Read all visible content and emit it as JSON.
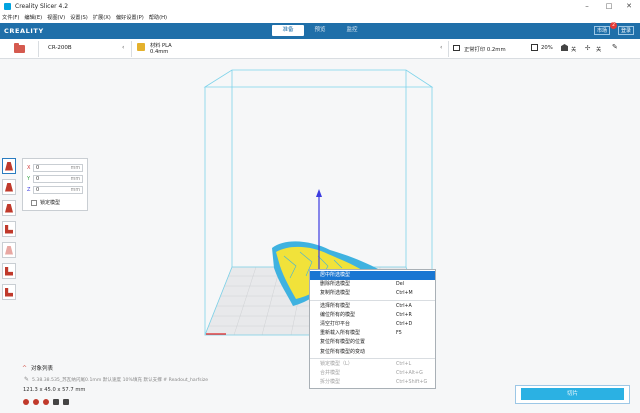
{
  "window": {
    "title": "Creality Slicer 4.2",
    "controls": {
      "minimize": "–",
      "maximize": "□",
      "close": "✕"
    }
  },
  "menubar": {
    "items": [
      "文件(F)",
      "编辑(E)",
      "视图(V)",
      "设置(S)",
      "扩展(X)",
      "偏好设置(P)",
      "帮助(H)"
    ]
  },
  "header": {
    "logo": "CREALITY",
    "tabs": [
      "准备",
      "预览",
      "监控"
    ],
    "active_tab": 0,
    "buttons": {
      "left": "市场",
      "right": "登录"
    },
    "badge": "2"
  },
  "toolbar": {
    "printer": "CR-200B",
    "material_label": "材料 PLA",
    "material_sub": "0.4mm",
    "quality": "正常打印 0.2mm",
    "infill": "20%",
    "support": "关",
    "adhesion": "关"
  },
  "icons": {
    "open_file": "folder-icon",
    "chevron": "‹",
    "edit": "✎",
    "adhesion": "✢"
  },
  "move_panel": {
    "x_label": "X",
    "x_value": "0",
    "x_unit": "mm",
    "y_label": "Y",
    "y_value": "0",
    "y_unit": "mm",
    "z_label": "Z",
    "z_value": "0",
    "z_unit": "mm",
    "lock_label": "锁定模型"
  },
  "context_menu": {
    "items": [
      {
        "label": "居中所选模型",
        "shortcut": "",
        "highlighted": true
      },
      {
        "label": "删除所选模型",
        "shortcut": "Del"
      },
      {
        "label": "复制所选模型",
        "shortcut": "Ctrl+M"
      },
      {
        "label": "选择所有模型",
        "shortcut": "Ctrl+A"
      },
      {
        "label": "编位所有的模型",
        "shortcut": "Ctrl+R"
      },
      {
        "label": "清空打印平台",
        "shortcut": "Ctrl+D"
      },
      {
        "label": "重新载入所有模型",
        "shortcut": "F5"
      },
      {
        "label": "复位所有模型的位置",
        "shortcut": ""
      },
      {
        "label": "复位所有模型的变动",
        "shortcut": ""
      },
      {
        "label": "锁定模型（L）",
        "shortcut": "Ctrl+L",
        "disabled": true
      },
      {
        "label": "合并模型",
        "shortcut": "Ctrl+Alt+G",
        "disabled": true
      },
      {
        "label": "拆分模型",
        "shortcut": "Ctrl+Shift+G",
        "disabled": true
      }
    ]
  },
  "object_list": {
    "header": "对象列表",
    "caret": "^",
    "row": "5.38.38.535_苏瓦纳闪尾0.1mm 默认速度 10%填充 默认支撑 # Readout_harfsize",
    "dimensions": "121.3 x 45.0 x 57.7 mm"
  },
  "slice": {
    "label": "切片"
  },
  "colors": {
    "header_blue": "#1f6fa9",
    "accent_cyan": "#2bb1e3",
    "menu_highlight": "#1976d2",
    "volume_edge": "#7dd3ea",
    "model_yellow": "#f1e23a",
    "model_blue": "#3fb2e0"
  }
}
